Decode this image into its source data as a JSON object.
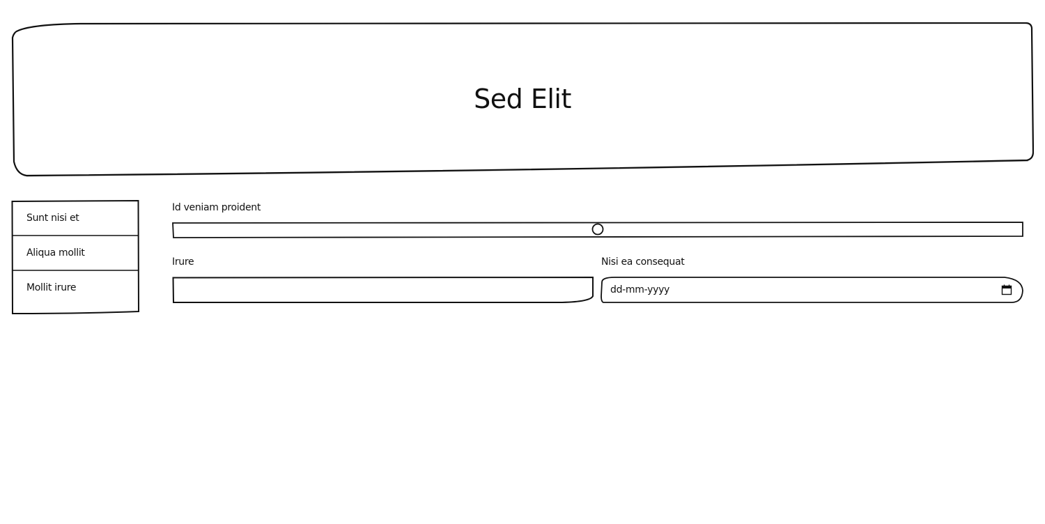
{
  "header": {
    "title": "Sed Elit"
  },
  "sidebar": {
    "items": [
      {
        "label": "Sunt nisi et"
      },
      {
        "label": "Aliqua mollit"
      },
      {
        "label": "Mollit irure"
      }
    ]
  },
  "form": {
    "range": {
      "label": "Id veniam proident",
      "value_fraction": 0.5
    },
    "text_field": {
      "label": "Irure",
      "value": "",
      "placeholder": ""
    },
    "date_field": {
      "label": "Nisi ea consequat",
      "placeholder": "dd-mm-yyyy",
      "icon": "calendar-icon"
    }
  }
}
